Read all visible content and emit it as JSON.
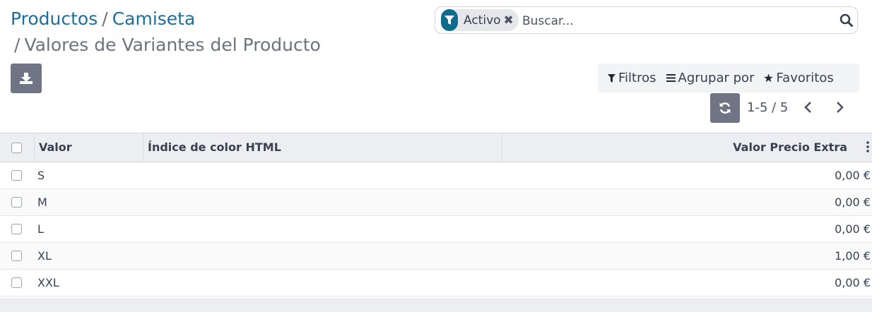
{
  "breadcrumb": {
    "items": [
      "Productos",
      "Camiseta"
    ],
    "separator": "/",
    "current": "Valores de Variantes del Producto"
  },
  "search": {
    "facet_label": "Activo",
    "facet_remove": "✖",
    "placeholder": "Buscar..."
  },
  "toolbar": {
    "filters": "Filtros",
    "group_by": "Agrupar por",
    "favorites": "Favoritos"
  },
  "pager": {
    "value": "1-5 / 5"
  },
  "table": {
    "columns": [
      "Valor",
      "Índice de color HTML",
      "Valor Precio Extra"
    ],
    "rows": [
      {
        "valor": "S",
        "color": "",
        "price": "0,00 €"
      },
      {
        "valor": "M",
        "color": "",
        "price": "0,00 €"
      },
      {
        "valor": "L",
        "color": "",
        "price": "0,00 €"
      },
      {
        "valor": "XL",
        "color": "",
        "price": "1,00 €"
      },
      {
        "valor": "XXL",
        "color": "",
        "price": "0,00 €"
      }
    ]
  },
  "colors": {
    "link": "#1d6f9b",
    "button": "#6f7584",
    "facet_icon": "#0e6a8f"
  },
  "icons": [
    "download-icon",
    "filter-icon",
    "close-icon",
    "search-icon",
    "bars-icon",
    "star-icon",
    "refresh-icon",
    "chevron-left-icon",
    "chevron-right-icon",
    "options-icon"
  ]
}
